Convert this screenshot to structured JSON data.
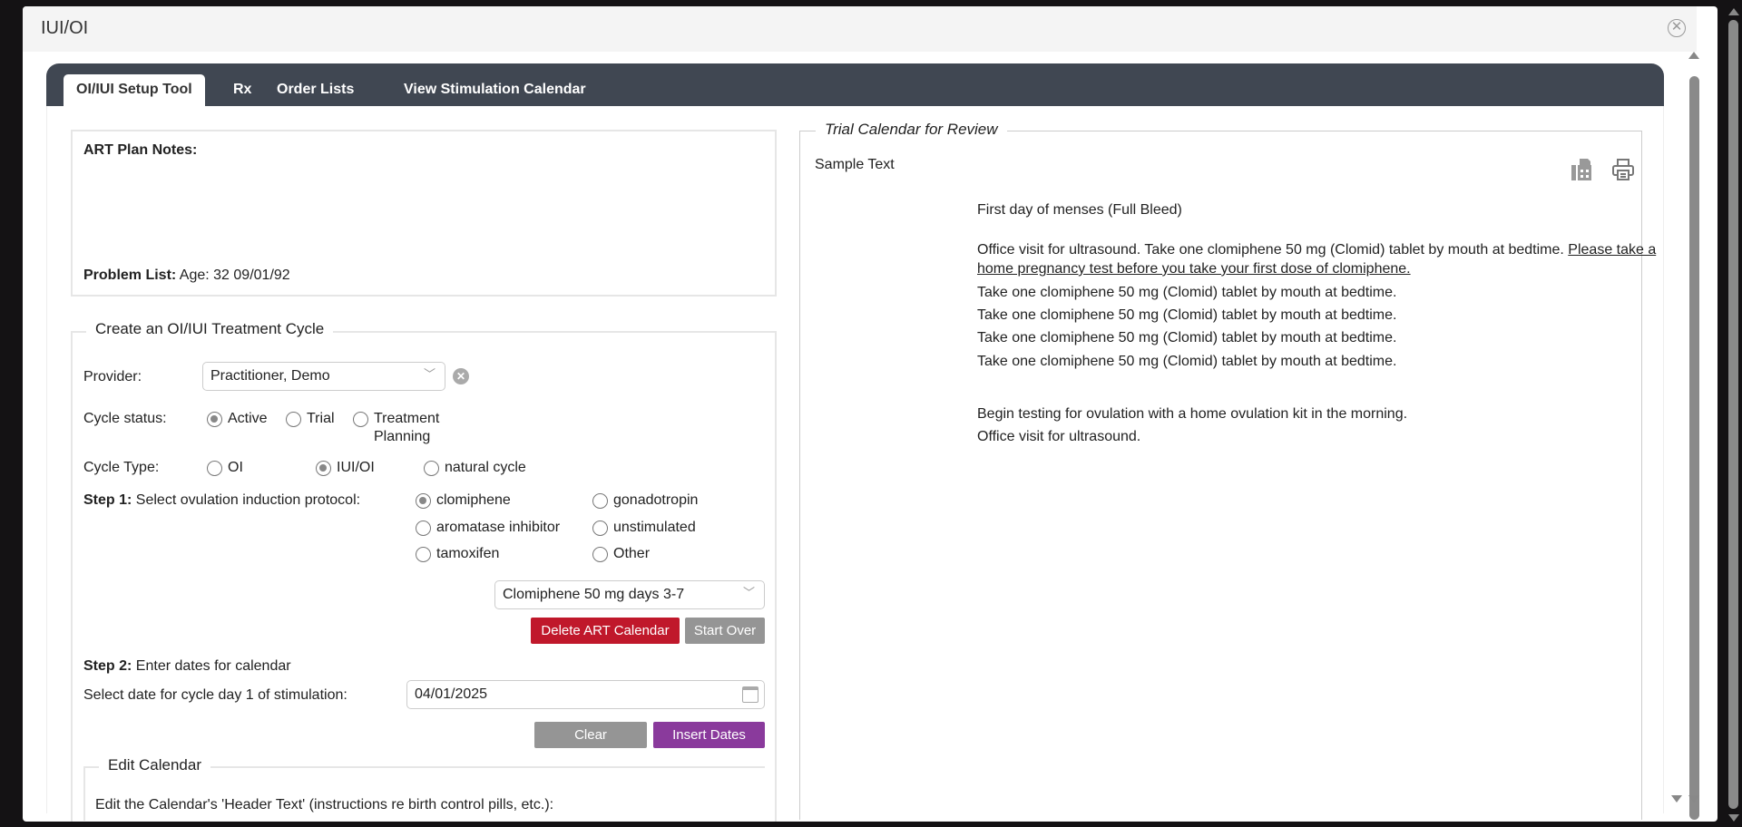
{
  "window": {
    "title": "IUI/OI"
  },
  "tabs": [
    {
      "label": "OI/IUI Setup Tool"
    },
    {
      "label": "Rx"
    },
    {
      "label": "Order Lists"
    },
    {
      "label": "View Stimulation Calendar"
    }
  ],
  "art": {
    "notes_label": "ART Plan Notes:",
    "problem_label": "Problem List:",
    "problem_value": "Age: 32 09/01/92"
  },
  "cycle": {
    "legend": "Create an OI/IUI Treatment Cycle",
    "provider_label": "Provider:",
    "provider_value": "Practitioner, Demo",
    "status_label": "Cycle status:",
    "status_options": [
      "Active",
      "Trial",
      "Treatment",
      "Planning"
    ],
    "type_label": "Cycle Type:",
    "type_options": [
      "OI",
      "IUI/OI",
      "natural cycle"
    ],
    "step1_bold": "Step 1:",
    "step1_text": "Select ovulation induction protocol:",
    "protocols": [
      "clomiphene",
      "gonadotropin",
      "aromatase inhibitor",
      "unstimulated",
      "tamoxifen",
      "Other"
    ],
    "protocol_select": "Clomiphene 50 mg days 3-7",
    "delete_btn": "Delete ART Calendar",
    "start_over_btn": "Start Over",
    "step2_bold": "Step 2:",
    "step2_text": "Enter dates for calendar",
    "date_label": "Select date for cycle day 1 of stimulation:",
    "date_value": "04/01/2025",
    "clear_btn": "Clear",
    "insert_btn": "Insert Dates",
    "edit_legend": "Edit Calendar",
    "edit_text": "Edit the Calendar's 'Header Text' (instructions re birth control pills, etc.):"
  },
  "trial": {
    "legend": "Trial Calendar for Review",
    "sample": "Sample Text",
    "lines": [
      "First day of menses (Full Bleed)",
      "Office visit for ultrasound. Take one clomiphene 50 mg (Clomid) tablet by mouth at bedtime. ",
      "Please take a",
      "home pregnancy test before you take your first dose of clomiphene.",
      "Take one clomiphene 50 mg (Clomid) tablet by mouth at bedtime.",
      "Take one clomiphene 50 mg (Clomid) tablet by mouth at bedtime.",
      "Take one clomiphene 50 mg (Clomid) tablet by mouth at bedtime.",
      "Take one clomiphene 50 mg (Clomid) tablet by mouth at bedtime.",
      "Begin testing for ovulation with a home ovulation kit in the morning.",
      "Office visit for ultrasound."
    ]
  },
  "colors": {
    "tabbar": "#404752",
    "delete": "#c0182b",
    "gray": "#959595",
    "purple": "#8a3a9c"
  }
}
